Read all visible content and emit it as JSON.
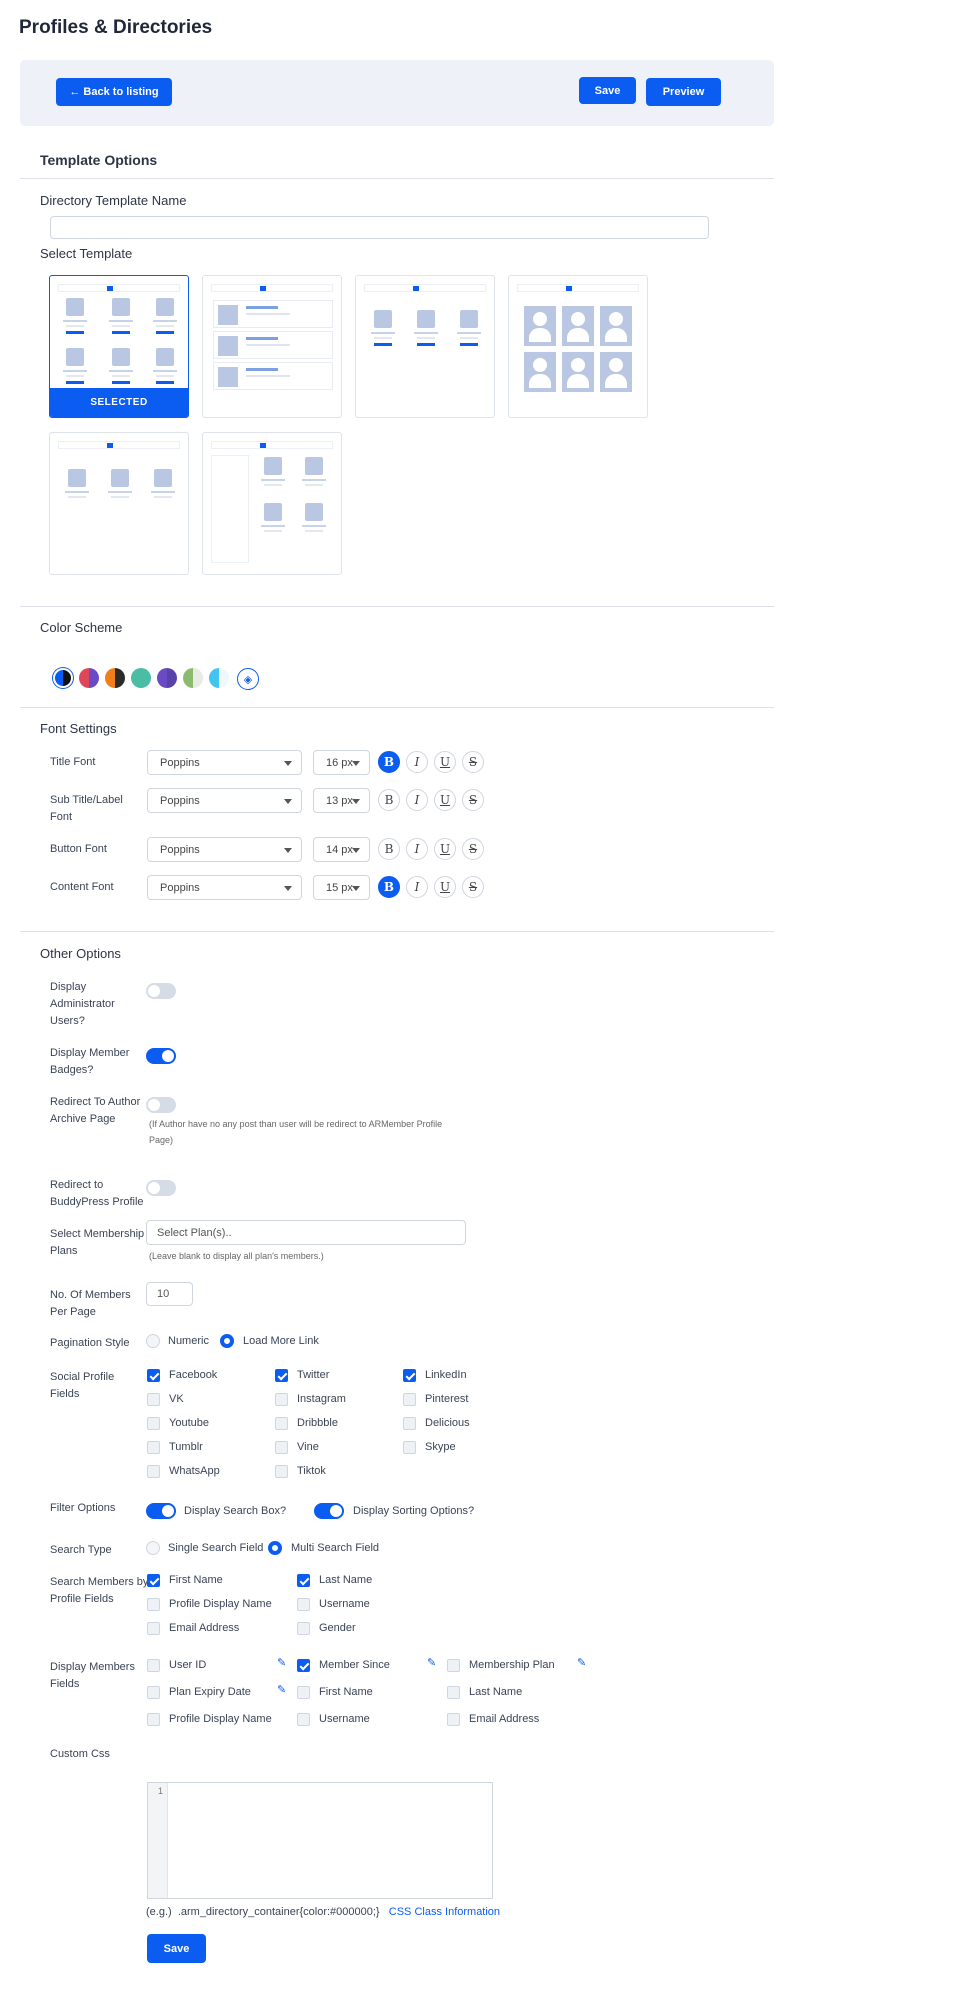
{
  "page": {
    "title": "Profiles & Directories"
  },
  "toolbar": {
    "back_label": "← Back to listing",
    "save_label": "Save",
    "preview_label": "Preview"
  },
  "template_options": {
    "title": "Template Options",
    "name_label": "Directory Template Name",
    "name_value": "",
    "select_label": "Select Template",
    "selected_label": "SELECTED"
  },
  "color_scheme": {
    "title": "Color Scheme",
    "swatches": [
      {
        "a": "#0b5cf0",
        "b": "#111111"
      },
      {
        "a": "#e0465a",
        "b": "#6a4bc4"
      },
      {
        "a": "#f07e1b",
        "b": "#2a2a2a"
      },
      {
        "a": "#4bbda5",
        "b": "#4bbda5"
      },
      {
        "a": "#6a4bc4",
        "b": "#5a43a8"
      },
      {
        "a": "#8dbb6e",
        "b": "#e8ebe4"
      },
      {
        "a": "#42c3f0",
        "b": "#eef7fb"
      }
    ],
    "custom_icon": "paint-bucket-icon"
  },
  "font_settings": {
    "title": "Font Settings",
    "rows": [
      {
        "label": "Title Font",
        "font": "Poppins",
        "size": "16 px",
        "bold": true
      },
      {
        "label": "Sub Title/Label Font",
        "font": "Poppins",
        "size": "13 px",
        "bold": false
      },
      {
        "label": "Button Font",
        "font": "Poppins",
        "size": "14 px",
        "bold": false
      },
      {
        "label": "Content Font",
        "font": "Poppins",
        "size": "15 px",
        "bold": true
      }
    ],
    "b": "B",
    "i": "I",
    "u": "U",
    "s": "S"
  },
  "other_options": {
    "title": "Other Options",
    "display_admin_label": "Display Administrator Users?",
    "display_badges_label": "Display Member Badges?",
    "redirect_author_label": "Redirect To Author Archive Page",
    "redirect_author_note": "(If Author have no any post than user will be redirect to ARMember Profile Page)",
    "redirect_bp_label": "Redirect to BuddyPress Profile",
    "plans_label": "Select Membership Plans",
    "plans_placeholder": "Select Plan(s)..",
    "plans_note": "(Leave blank to display all plan's members.)",
    "per_page_label": "No. Of Members Per Page",
    "per_page_value": "10",
    "pagination_label": "Pagination Style",
    "pagination_numeric": "Numeric",
    "pagination_load_more": "Load More Link",
    "social_label": "Social Profile Fields",
    "social": [
      {
        "name": "Facebook",
        "checked": true
      },
      {
        "name": "Twitter",
        "checked": true
      },
      {
        "name": "LinkedIn",
        "checked": true
      },
      {
        "name": "VK",
        "checked": false
      },
      {
        "name": "Instagram",
        "checked": false
      },
      {
        "name": "Pinterest",
        "checked": false
      },
      {
        "name": "Youtube",
        "checked": false
      },
      {
        "name": "Dribbble",
        "checked": false
      },
      {
        "name": "Delicious",
        "checked": false
      },
      {
        "name": "Tumblr",
        "checked": false
      },
      {
        "name": "Vine",
        "checked": false
      },
      {
        "name": "Skype",
        "checked": false
      },
      {
        "name": "WhatsApp",
        "checked": false
      },
      {
        "name": "Tiktok",
        "checked": false
      }
    ],
    "filter_label": "Filter Options",
    "filter_search": "Display Search Box?",
    "filter_sorting": "Display Sorting Options?",
    "search_type_label": "Search Type",
    "search_single": "Single Search Field",
    "search_multi": "Multi Search Field",
    "search_members_label": "Search Members by Profile Fields",
    "search_fields": [
      {
        "name": "First Name",
        "checked": true
      },
      {
        "name": "Last Name",
        "checked": true
      },
      {
        "name": "Profile Display Name",
        "checked": false
      },
      {
        "name": "Username",
        "checked": false
      },
      {
        "name": "Email Address",
        "checked": false
      },
      {
        "name": "Gender",
        "checked": false
      }
    ],
    "display_fields_label": "Display Members Fields",
    "display_fields": [
      {
        "name": "User ID",
        "checked": false,
        "edit": true
      },
      {
        "name": "Member Since",
        "checked": true,
        "edit": true
      },
      {
        "name": "Membership Plan",
        "checked": false,
        "edit": true
      },
      {
        "name": "Plan Expiry Date",
        "checked": false,
        "edit": true
      },
      {
        "name": "First Name",
        "checked": false,
        "edit": false
      },
      {
        "name": "Last Name",
        "checked": false,
        "edit": false
      },
      {
        "name": "Profile Display Name",
        "checked": false,
        "edit": false
      },
      {
        "name": "Username",
        "checked": false,
        "edit": false
      },
      {
        "name": "Email Address",
        "checked": false,
        "edit": false
      }
    ],
    "custom_css_label": "Custom Css",
    "line_number": "1",
    "css_example_prefix": "(e.g.)",
    "css_example": ".arm_directory_container{color:#000000;}",
    "css_link": "CSS Class Information",
    "save_label": "Save"
  }
}
